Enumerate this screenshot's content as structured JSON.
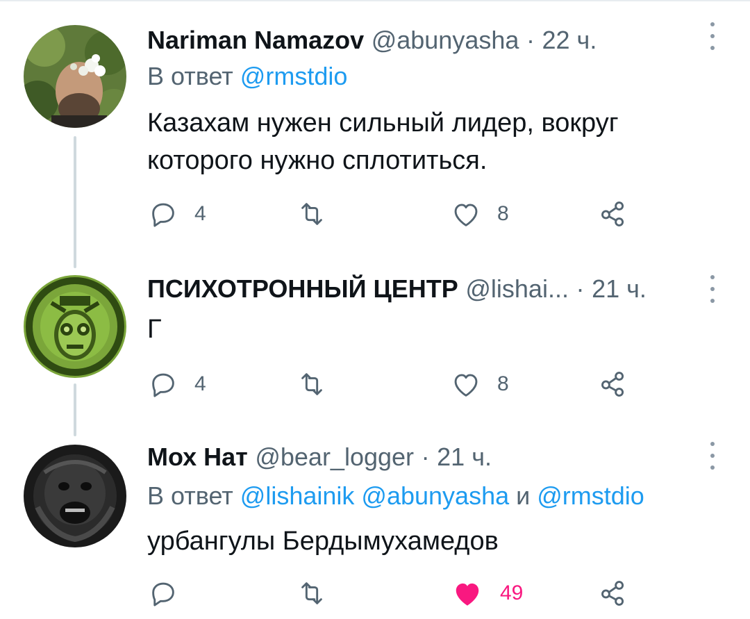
{
  "colors": {
    "accent": "#1d9bf0",
    "secondary_text": "#536471",
    "like_active": "#f91880",
    "thread_line": "#cfd9de"
  },
  "tweets": [
    {
      "name": "Nariman Namazov",
      "handle": "@abunyasha",
      "dot": "·",
      "time": "22 ч.",
      "reply_prefix": "В ответ",
      "mentions": [
        "@rmstdio"
      ],
      "text_lines": [
        "Казахам нужен сильный лидер, вокруг",
        "которого нужно сплотиться."
      ],
      "reply_count": "4",
      "retweet_count": "",
      "like_count": "8",
      "liked": false,
      "avatar_icon": "profile-photo-icon"
    },
    {
      "name": "ПСИХОТРОННЫЙ ЦЕНТР",
      "handle": "@lishai...",
      "dot": "·",
      "time": "21 ч.",
      "text_lines": [
        "Г"
      ],
      "reply_count": "4",
      "retweet_count": "",
      "like_count": "8",
      "liked": false,
      "avatar_icon": "green-illustration-icon"
    },
    {
      "name": "Мох Нат",
      "handle": "@bear_logger",
      "dot": "·",
      "time": "21 ч.",
      "reply_prefix": "В ответ",
      "mentions": [
        "@lishainik",
        "@abunyasha",
        "@rmstdio"
      ],
      "mention_joiner": "и",
      "text_lines": [
        "урбангулы Бердымухамедов"
      ],
      "reply_count": "",
      "retweet_count": "",
      "like_count": "49",
      "liked": true,
      "avatar_icon": "monkey-photo-icon"
    }
  ]
}
